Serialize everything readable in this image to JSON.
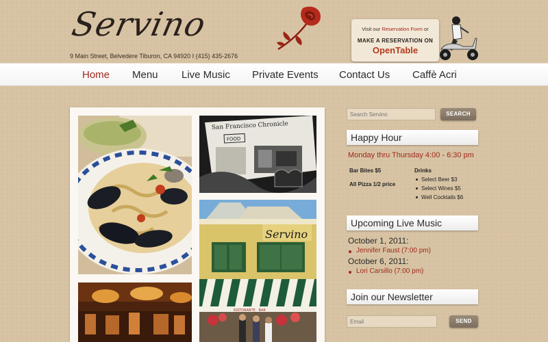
{
  "header": {
    "logo_text": "Servino",
    "address": "9 Main Street, Belvedere Tiburon, CA 94920  I  (415) 435-2676",
    "reservation": {
      "visit_prefix": "Visit our",
      "form_link": "Reservation Form",
      "or": "or",
      "make_reservation": "MAKE A RESERVATION  ON",
      "opentable": "OpenTable"
    }
  },
  "nav": {
    "items": [
      {
        "label": "Home",
        "active": true
      },
      {
        "label": "Menu"
      },
      {
        "label": "Live Music"
      },
      {
        "label": "Private Events"
      },
      {
        "label": "Contact Us"
      },
      {
        "label": "Caffè Acri"
      }
    ]
  },
  "photos": {
    "newspaper_masthead": "San Francisco Chronicle",
    "newspaper_section": "FOOD",
    "storefront_sign": "Servino",
    "awning_text": "RISTORANTE · BAR"
  },
  "sidebar": {
    "search": {
      "placeholder": "Search Servino",
      "button": "SEARCH"
    },
    "happy_hour": {
      "title": "Happy Hour",
      "schedule": "Monday thru Thursday 4:00 - 6:30 pm",
      "bar_bites": "Bar Bites $5",
      "pizza": "All Pizza 1/2 price",
      "drinks_title": "Drinks",
      "drinks": [
        "Select Beer $3",
        "Select Wines $5",
        "Well Cocktails $6"
      ]
    },
    "live_music": {
      "title": "Upcoming Live Music",
      "events": [
        {
          "date": "October 1, 2011:",
          "performer": "Jennifer Faust (7:00 pm)"
        },
        {
          "date": "October 6, 2011:",
          "performer": "Lori Carsillo (7:00 pm)"
        }
      ]
    },
    "newsletter": {
      "title": "Join our Newsletter",
      "placeholder": "Email",
      "button": "SEND"
    }
  },
  "colors": {
    "accent_red": "#a0281c",
    "background_tan": "#d7c3a3"
  }
}
